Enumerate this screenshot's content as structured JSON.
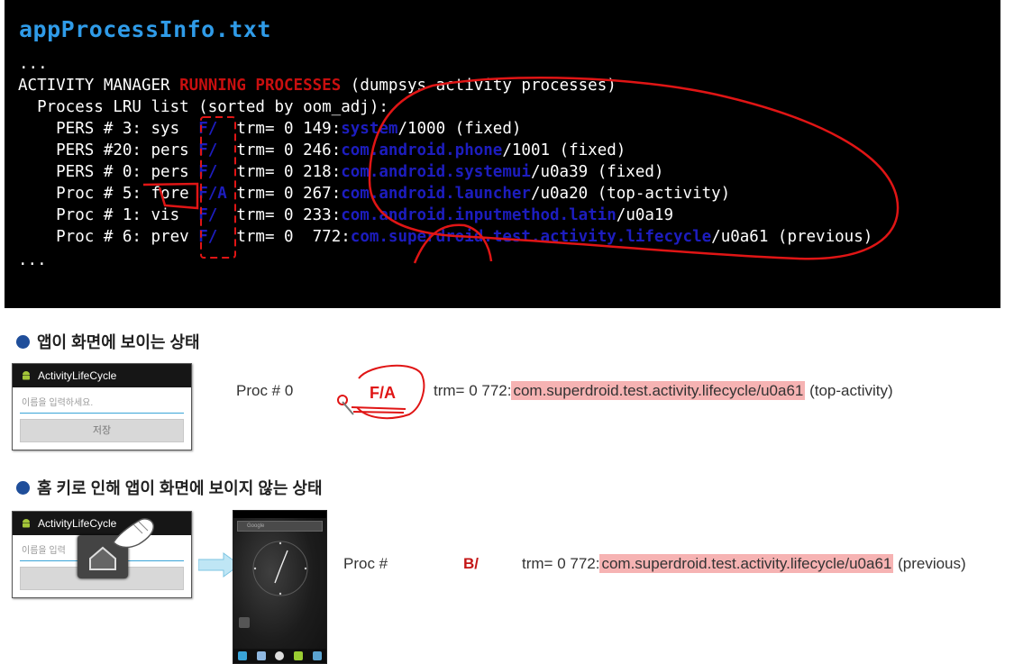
{
  "terminal": {
    "title": "appProcessInfo.txt",
    "ellipsis_top": "...",
    "header_prefix": "ACTIVITY MANAGER ",
    "header_highlight": "RUNNING PROCESSES",
    "header_suffix": " (dumpsys activity processes)",
    "lru_line": "  Process LRU list (sorted by oom_adj):",
    "rows": [
      {
        "pre": "    PERS # 3: sys  ",
        "flag": "F/",
        "mid": "  trm= 0 149:",
        "pkg": "system",
        "post": "/1000 (fixed)"
      },
      {
        "pre": "    PERS #20: pers ",
        "flag": "F/",
        "mid": "  trm= 0 246:",
        "pkg": "com.android.phone",
        "post": "/1001 (fixed)"
      },
      {
        "pre": "    PERS # 0: pers ",
        "flag": "F/",
        "mid": "  trm= 0 218:",
        "pkg": "com.android.systemui",
        "post": "/u0a39 (fixed)"
      },
      {
        "pre": "    Proc # 5: fore ",
        "flag": "F/A",
        "mid": " trm= 0 267:",
        "pkg": "com.android.launcher",
        "post": "/u0a20 (top-activity)"
      },
      {
        "pre": "    Proc # 1: vis  ",
        "flag": "F/",
        "mid": "  trm= 0 233:",
        "pkg": "com.android.inputmethod.latin",
        "post": "/u0a19"
      },
      {
        "pre": "    Proc # 6: prev ",
        "flag": "F/",
        "mid": "  trm= 0  772:",
        "pkg": "com.superdroid.test.activity.lifecycle",
        "post": "/u0a61 (previous)"
      }
    ],
    "ellipsis_bottom": "..."
  },
  "section1": {
    "heading": "앱이 화면에 보이는 상태",
    "phone": {
      "title": "ActivityLifeCycle",
      "placeholder": "이름을 입력하세요.",
      "button": "저장"
    },
    "proc": "Proc # 0",
    "flag": "F/A",
    "prefix": "trm= 0 772:",
    "pkg": "com.superdroid.test.activity.lifecycle/u0a61",
    "suffix": " (top-activity)"
  },
  "section2": {
    "heading": "홈 키로 인해 앱이 화면에 보이지 않는 상태",
    "phone": {
      "title": "ActivityLifeCycle",
      "placeholder": "이름을 입력"
    },
    "home_search": "Google",
    "proc": "Proc #",
    "flag": "B/",
    "prefix": "trm= 0 772:",
    "pkg": "com.superdroid.test.activity.lifecycle/u0a61",
    "suffix": " (previous)"
  },
  "colors": {
    "title_blue": "#2f9be8",
    "highlight_red": "#c80f0f",
    "package_blue": "#1d1dbf",
    "annotation_red": "#e01515",
    "row_highlight": "#f6b3b3",
    "bullet_blue": "#1f4e9a"
  },
  "icons": [
    "android-icon",
    "home-key-icon",
    "hand-pointer-icon",
    "arrow-right-icon",
    "clock-widget-icon"
  ]
}
